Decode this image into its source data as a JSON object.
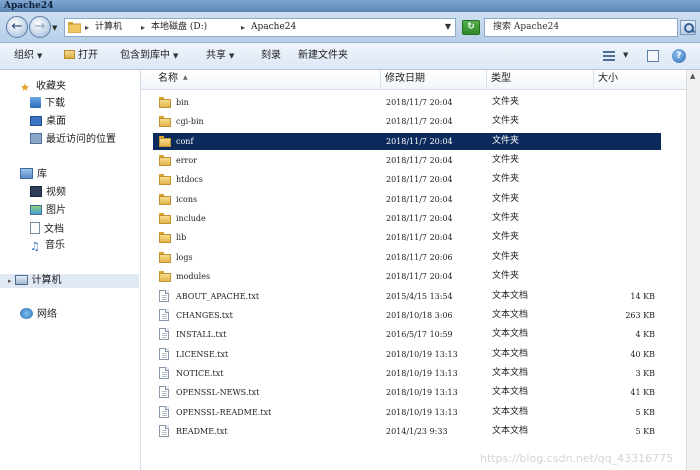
{
  "window": {
    "title": "Apache24"
  },
  "address": {
    "crumbs": [
      "计算机",
      "本地磁盘 (D:)",
      "Apache24"
    ],
    "search_placeholder": "搜索 Apache24"
  },
  "toolbar": {
    "organize": "组织",
    "open": "打开",
    "include_in_library": "包含到库中",
    "share": "共享",
    "burn": "刻录",
    "new_folder": "新建文件夹"
  },
  "nav": {
    "favorites": "收藏夹",
    "downloads": "下载",
    "desktop": "桌面",
    "recent": "最近访问的位置",
    "libraries": "库",
    "videos": "视频",
    "pictures": "图片",
    "documents": "文档",
    "music": "音乐",
    "computer": "计算机",
    "network": "网络"
  },
  "columns": {
    "name": "名称",
    "modified": "修改日期",
    "type": "类型",
    "size": "大小"
  },
  "files": [
    {
      "name": "bin",
      "modified": "2018/11/7 20:04",
      "type": "文件夹",
      "size": "",
      "kind": "folder"
    },
    {
      "name": "cgi-bin",
      "modified": "2018/11/7 20:04",
      "type": "文件夹",
      "size": "",
      "kind": "folder"
    },
    {
      "name": "conf",
      "modified": "2018/11/7 20:04",
      "type": "文件夹",
      "size": "",
      "kind": "folder",
      "selected": true
    },
    {
      "name": "error",
      "modified": "2018/11/7 20:04",
      "type": "文件夹",
      "size": "",
      "kind": "folder"
    },
    {
      "name": "htdocs",
      "modified": "2018/11/7 20:04",
      "type": "文件夹",
      "size": "",
      "kind": "folder"
    },
    {
      "name": "icons",
      "modified": "2018/11/7 20:04",
      "type": "文件夹",
      "size": "",
      "kind": "folder"
    },
    {
      "name": "include",
      "modified": "2018/11/7 20:04",
      "type": "文件夹",
      "size": "",
      "kind": "folder"
    },
    {
      "name": "lib",
      "modified": "2018/11/7 20:04",
      "type": "文件夹",
      "size": "",
      "kind": "folder"
    },
    {
      "name": "logs",
      "modified": "2018/11/7 20:06",
      "type": "文件夹",
      "size": "",
      "kind": "folder"
    },
    {
      "name": "modules",
      "modified": "2018/11/7 20:04",
      "type": "文件夹",
      "size": "",
      "kind": "folder"
    },
    {
      "name": "ABOUT_APACHE.txt",
      "modified": "2015/4/15 13:54",
      "type": "文本文档",
      "size": "14 KB",
      "kind": "file"
    },
    {
      "name": "CHANGES.txt",
      "modified": "2018/10/18 3:06",
      "type": "文本文档",
      "size": "263 KB",
      "kind": "file"
    },
    {
      "name": "INSTALL.txt",
      "modified": "2016/5/17 10:59",
      "type": "文本文档",
      "size": "4 KB",
      "kind": "file"
    },
    {
      "name": "LICENSE.txt",
      "modified": "2018/10/19 13:13",
      "type": "文本文档",
      "size": "40 KB",
      "kind": "file"
    },
    {
      "name": "NOTICE.txt",
      "modified": "2018/10/19 13:13",
      "type": "文本文档",
      "size": "3 KB",
      "kind": "file"
    },
    {
      "name": "OPENSSL-NEWS.txt",
      "modified": "2018/10/19 13:13",
      "type": "文本文档",
      "size": "41 KB",
      "kind": "file"
    },
    {
      "name": "OPENSSL-README.txt",
      "modified": "2018/10/19 13:13",
      "type": "文本文档",
      "size": "5 KB",
      "kind": "file"
    },
    {
      "name": "README.txt",
      "modified": "2014/1/23 9:33",
      "type": "文本文档",
      "size": "5 KB",
      "kind": "file"
    }
  ],
  "watermark": "https://blog.csdn.net/qq_43316775",
  "colors": {
    "selection": "#0c2a5c",
    "toolbar": "#dde8f5",
    "title": "#5d86b6"
  }
}
